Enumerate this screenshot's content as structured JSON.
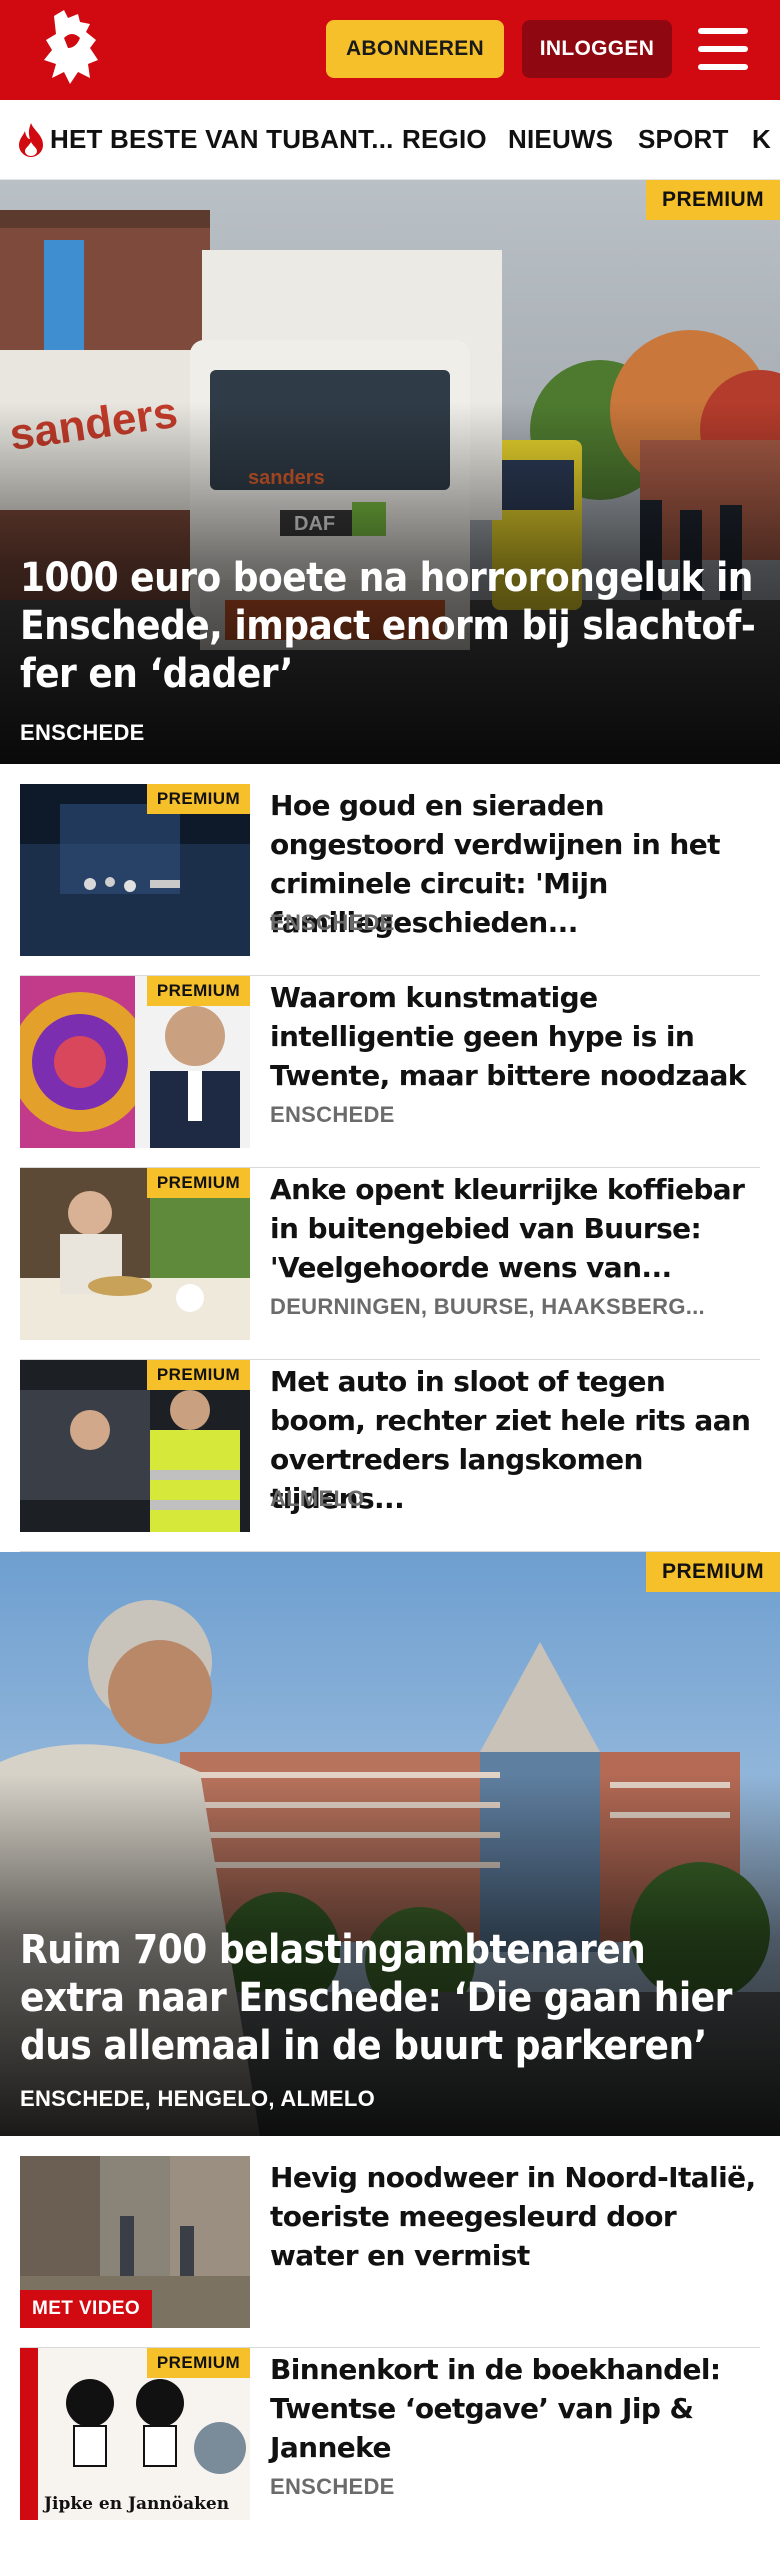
{
  "header": {
    "logo_icon": "tubantia-horse-logo-icon",
    "subscribe_label": "ABONNEREN",
    "login_label": "INLOGGEN",
    "menu_icon": "hamburger-menu-icon",
    "brand_color": "#d10a11",
    "accent_color": "#f6c02b"
  },
  "nav": {
    "items": [
      {
        "label": "HET BESTE VAN TUBANT...",
        "icon": "flame-icon"
      },
      {
        "label": "REGIO"
      },
      {
        "label": "NIEUWS"
      },
      {
        "label": "SPORT"
      },
      {
        "label": "K"
      }
    ]
  },
  "hero1": {
    "badge": "PREMIUM",
    "title": "1000 euro boete na horrorongeluk in Enschede, impact enorm bij slachtof­fer en ‘dader’",
    "location": "ENSCHEDE"
  },
  "articles1": [
    {
      "badge": "PREMIUM",
      "title": "Hoe goud en sieraden ongestoord verdwijnen in het criminele circuit: 'Mijn familiegeschieden...",
      "location": "ENSCHEDE"
    },
    {
      "badge": "PREMIUM",
      "title": "Waarom kunstmatige intelligen­tie geen hype is in Twente, maar bittere noodzaak",
      "location": "ENSCHEDE"
    },
    {
      "badge": "PREMIUM",
      "title": "Anke opent kleurrijke koffiebar in buitengebied van Buurse: 'Veelgehoorde wens van...",
      "location": "DEURNINGEN, BUURSE, HAAKSBERG..."
    },
    {
      "badge": "PREMIUM",
      "title": "Met auto in sloot of tegen boom, rechter ziet hele rits aan overtre­ders langskomen tijdens...",
      "location": "ALMELO"
    }
  ],
  "hero2": {
    "badge": "PREMIUM",
    "title": "Ruim 700 belastingambtenaren extra naar Enschede: ‘Die gaan hier dus allemaal in de buurt parkeren’",
    "location": "ENSCHEDE, HENGELO, ALMELO"
  },
  "articles2": [
    {
      "badge": "MET VIDEO",
      "title": "Hevig noodweer in Noord-Italië, toeriste meegesleurd door water en vermist",
      "location": ""
    },
    {
      "badge": "PREMIUM",
      "title": "Binnenkort in de boekhandel: Twentse ‘oetgave’ van Jip & Janneke",
      "location": "ENSCHEDE",
      "thumb_text": "Jipke en Jannöaken"
    }
  ]
}
